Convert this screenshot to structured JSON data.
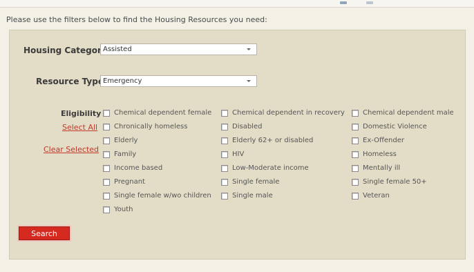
{
  "intro_text": "Please use the filters below to find the Housing Resources you need:",
  "housing_category": {
    "label": "Housing Category",
    "value": "Assisted"
  },
  "resource_type": {
    "label": "Resource Type",
    "value": "Emergency"
  },
  "eligibility": {
    "label": "Eligibility",
    "select_all": "Select All",
    "clear_selected": "Clear Selected",
    "columns": [
      [
        "Chemical dependent female",
        "Chronically homeless",
        "Elderly",
        "Family",
        "Income based",
        "Pregnant",
        "Single female w/wo children",
        "Youth"
      ],
      [
        "Chemical dependent in recovery",
        "Disabled",
        "Elderly 62+ or disabled",
        "HIV",
        "Low-Moderate income",
        "Single female",
        "Single male"
      ],
      [
        "Chemical dependent male",
        "Domestic Violence",
        "Ex-Offender",
        "Homeless",
        "Mentally ill",
        "Single female 50+",
        "Veteran"
      ]
    ]
  },
  "search_label": "Search",
  "colors": {
    "accent_red": "#d42a1f",
    "panel_bg": "#e3dcc7",
    "link_red": "#c0392b"
  }
}
